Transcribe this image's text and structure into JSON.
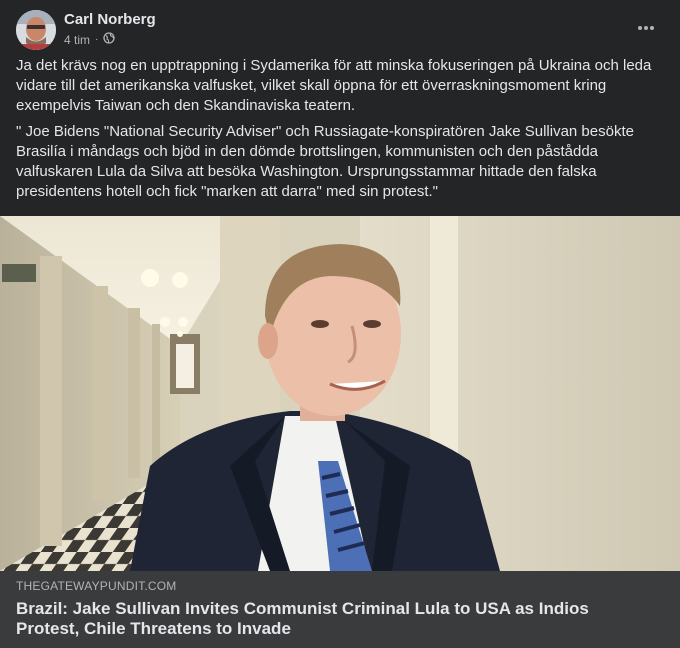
{
  "post": {
    "author": "Carl Norberg",
    "time": "4 tim",
    "separator": "·",
    "privacy_icon": "globe-icon",
    "menu_icon": "more-horizontal-icon",
    "paragraphs": [
      "Ja det krävs nog en upptrappning i Sydamerika för att minska fokuseringen på Ukraina och leda vidare till det amerikanska valfusket, vilket skall öppna för ett överraskningsmoment kring exempelvis Taiwan och den Skandinaviska teatern.",
      "\" Joe Bidens \"National Security Adviser\" och Russiagate-konspiratören Jake Sullivan besökte Brasilía i måndags och bjöd in den dömde brottslingen, kommunisten och den påstådda valfuskaren Lula da Silva att besöka Washington. Ursprungsstammar hittade den falska presidentens hotell och fick \"marken att darra\" med sin protest.\""
    ]
  },
  "link": {
    "domain": "THEGATEWAYPUNDIT.COM",
    "title": "Brazil: Jake Sullivan Invites Communist Criminal Lula to USA as Indios Protest, Chile Threatens to Invade"
  },
  "colors": {
    "background": "#242526",
    "card": "#3a3b3c",
    "text_primary": "#e4e6eb",
    "text_secondary": "#b0b3b8"
  }
}
